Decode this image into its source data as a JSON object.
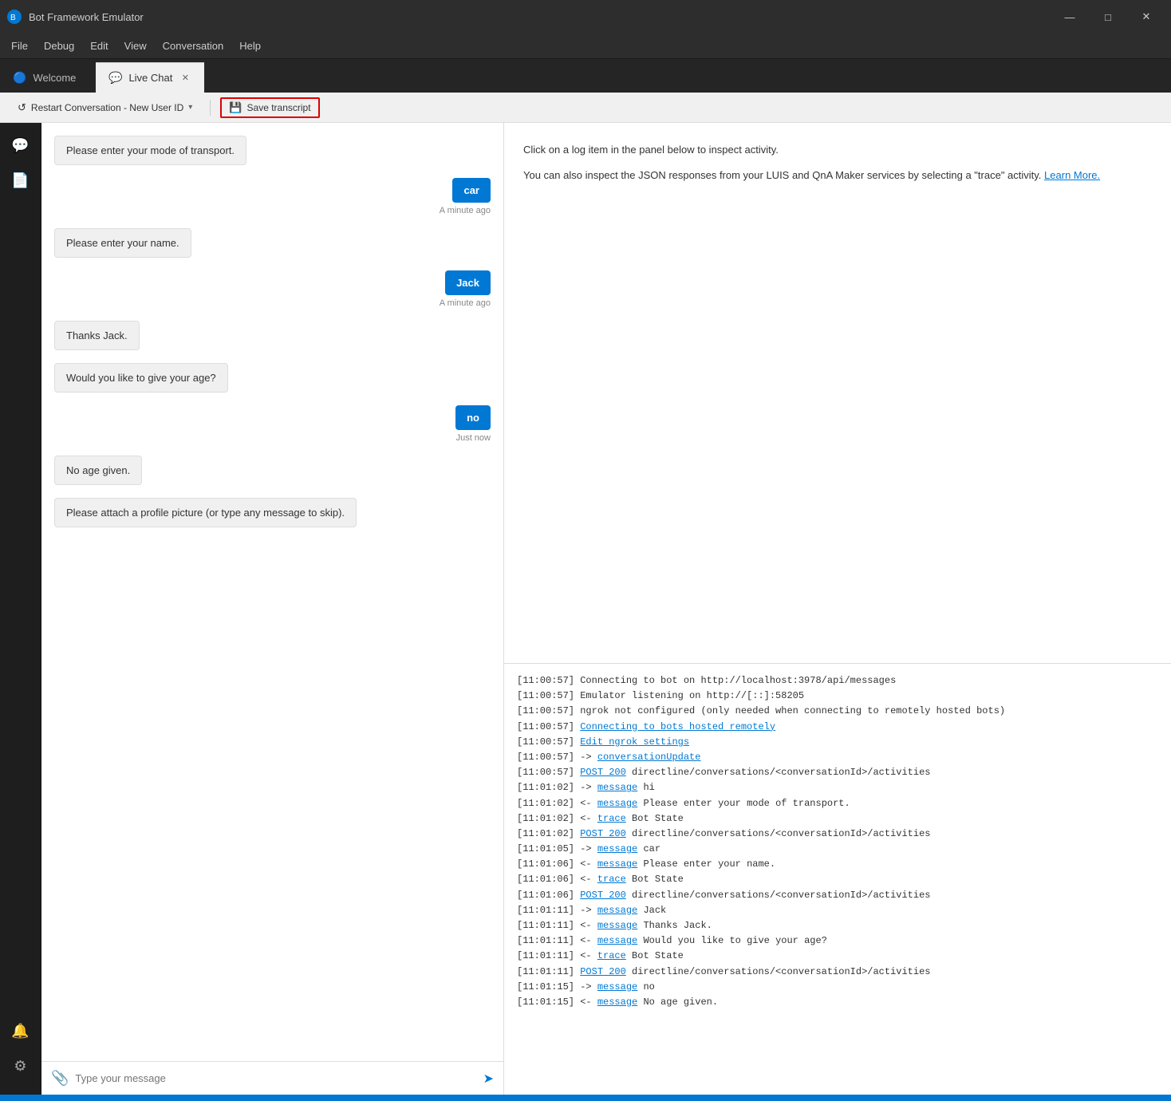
{
  "titleBar": {
    "title": "Bot Framework Emulator",
    "controls": [
      "minimize",
      "maximize",
      "close"
    ]
  },
  "menuBar": {
    "items": [
      "File",
      "Debug",
      "Edit",
      "View",
      "Conversation",
      "Help"
    ]
  },
  "tabs": [
    {
      "id": "welcome",
      "label": "Welcome",
      "icon": "🔵",
      "active": false,
      "closeable": false
    },
    {
      "id": "livechat",
      "label": "Live Chat",
      "icon": "💬",
      "active": true,
      "closeable": true
    }
  ],
  "toolbar": {
    "restartLabel": "Restart Conversation - New User ID",
    "saveTranscriptLabel": "Save transcript"
  },
  "chatMessages": [
    {
      "type": "bot",
      "text": "Please enter your mode of transport."
    },
    {
      "type": "user",
      "text": "car",
      "time": "A minute ago"
    },
    {
      "type": "bot",
      "text": "Please enter your name."
    },
    {
      "type": "user",
      "text": "Jack",
      "time": "A minute ago"
    },
    {
      "type": "bot",
      "text": "Thanks Jack."
    },
    {
      "type": "bot",
      "text": "Would you like to give your age?"
    },
    {
      "type": "user",
      "text": "no",
      "time": "Just now"
    },
    {
      "type": "bot",
      "text": "No age given."
    },
    {
      "type": "bot",
      "text": "Please attach a profile picture (or type any message to skip)."
    }
  ],
  "chatInput": {
    "placeholder": "Type your message"
  },
  "inspector": {
    "description": "Click on a log item in the panel below to inspect activity.",
    "description2": "You can also inspect the JSON responses from your LUIS and QnA Maker services by selecting a \"trace\" activity.",
    "learnMoreLabel": "Learn More.",
    "learnMoreUrl": "#"
  },
  "logPanel": {
    "lines": [
      {
        "text": "[11:00:57] Connecting to bot on http://localhost:3978/api/messages",
        "type": "plain"
      },
      {
        "text": "[11:00:57] Emulator listening on http://[::]:58205",
        "type": "plain"
      },
      {
        "text": "[11:00:57] ngrok not configured (only needed when connecting to remotely hosted bots)",
        "type": "plain"
      },
      {
        "text": "[11:00:57] ",
        "type": "plain",
        "link": "Connecting to bots hosted remotely",
        "linkId": "connect-remote"
      },
      {
        "text": "[11:00:57] ",
        "type": "plain",
        "link": "Edit ngrok settings",
        "linkId": "edit-ngrok"
      },
      {
        "text": "[11:00:57] -> ",
        "type": "plain",
        "link": "conversationUpdate",
        "linkId": "conv-update"
      },
      {
        "text": "[11:00:57] ",
        "type": "plain",
        "link": "POST 200",
        "linkId": "post-200-1",
        "after": " directline/conversations/<conversationId>/activities"
      },
      {
        "text": "[11:01:02] -> ",
        "type": "plain",
        "link": "message",
        "linkId": "msg-hi",
        "after": " hi"
      },
      {
        "text": "[11:01:02] <- ",
        "type": "plain",
        "link": "message",
        "linkId": "msg-transport",
        "after": " Please enter your mode of transport."
      },
      {
        "text": "[11:01:02] <- ",
        "type": "plain",
        "link": "trace",
        "linkId": "trace-1",
        "after": " Bot State"
      },
      {
        "text": "[11:01:02] ",
        "type": "plain",
        "link": "POST 200",
        "linkId": "post-200-2",
        "after": " directline/conversations/<conversationId>/activities"
      },
      {
        "text": "[11:01:05] -> ",
        "type": "plain",
        "link": "message",
        "linkId": "msg-car",
        "after": " car"
      },
      {
        "text": "[11:01:06] <- ",
        "type": "plain",
        "link": "message",
        "linkId": "msg-name",
        "after": " Please enter your name."
      },
      {
        "text": "[11:01:06] <- ",
        "type": "plain",
        "link": "trace",
        "linkId": "trace-2",
        "after": " Bot State"
      },
      {
        "text": "[11:01:06] ",
        "type": "plain",
        "link": "POST 200",
        "linkId": "post-200-3",
        "after": " directline/conversations/<conversationId>/activities"
      },
      {
        "text": "[11:01:11] -> ",
        "type": "plain",
        "link": "message",
        "linkId": "msg-jack",
        "after": " Jack"
      },
      {
        "text": "[11:01:11] <- ",
        "type": "plain",
        "link": "message",
        "linkId": "msg-thanks",
        "after": " Thanks Jack."
      },
      {
        "text": "[11:01:11] <- ",
        "type": "plain",
        "link": "message",
        "linkId": "msg-age",
        "after": " Would you like to give your age?"
      },
      {
        "text": "[11:01:11] <- ",
        "type": "plain",
        "link": "trace",
        "linkId": "trace-3",
        "after": " Bot State"
      },
      {
        "text": "[11:01:11] ",
        "type": "plain",
        "link": "POST 200",
        "linkId": "post-200-4",
        "after": " directline/conversations/<conversationId>/activities"
      },
      {
        "text": "[11:01:15] -> ",
        "type": "plain",
        "link": "message",
        "linkId": "msg-no",
        "after": " no"
      },
      {
        "text": "[11:01:15] <- ",
        "type": "plain",
        "link": "message",
        "linkId": "msg-noage",
        "after": " No age given."
      }
    ]
  },
  "sidebar": {
    "topIcons": [
      {
        "id": "chat-icon",
        "symbol": "💬",
        "active": true
      },
      {
        "id": "doc-icon",
        "symbol": "📄",
        "active": false
      }
    ],
    "bottomIcons": [
      {
        "id": "bell-icon",
        "symbol": "🔔"
      },
      {
        "id": "gear-icon",
        "symbol": "⚙"
      }
    ]
  }
}
